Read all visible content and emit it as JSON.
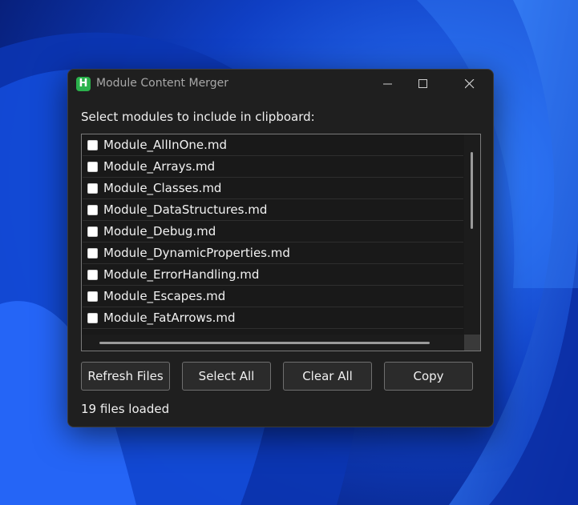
{
  "window": {
    "title": "Module Content Merger",
    "icon_letter": "H",
    "icon_color": "#2bb24c",
    "caption_icons": [
      "minimize-icon",
      "maximize-icon",
      "close-icon"
    ]
  },
  "prompt_label": "Select modules to include in clipboard:",
  "files": [
    {
      "label": "Module_AllInOne.md",
      "checked": false
    },
    {
      "label": "Module_Arrays.md",
      "checked": false
    },
    {
      "label": "Module_Classes.md",
      "checked": false
    },
    {
      "label": "Module_DataStructures.md",
      "checked": false
    },
    {
      "label": "Module_Debug.md",
      "checked": false
    },
    {
      "label": "Module_DynamicProperties.md",
      "checked": false
    },
    {
      "label": "Module_ErrorHandling.md",
      "checked": false
    },
    {
      "label": "Module_Escapes.md",
      "checked": false
    },
    {
      "label": "Module_FatArrows.md",
      "checked": false
    }
  ],
  "buttons": {
    "refresh": "Refresh Files",
    "select_all": "Select All",
    "clear_all": "Clear All",
    "copy": "Copy"
  },
  "status": "19 files loaded",
  "colors": {
    "window_bg": "#1f1f1f",
    "desktop_accent": "#1e56e0"
  }
}
